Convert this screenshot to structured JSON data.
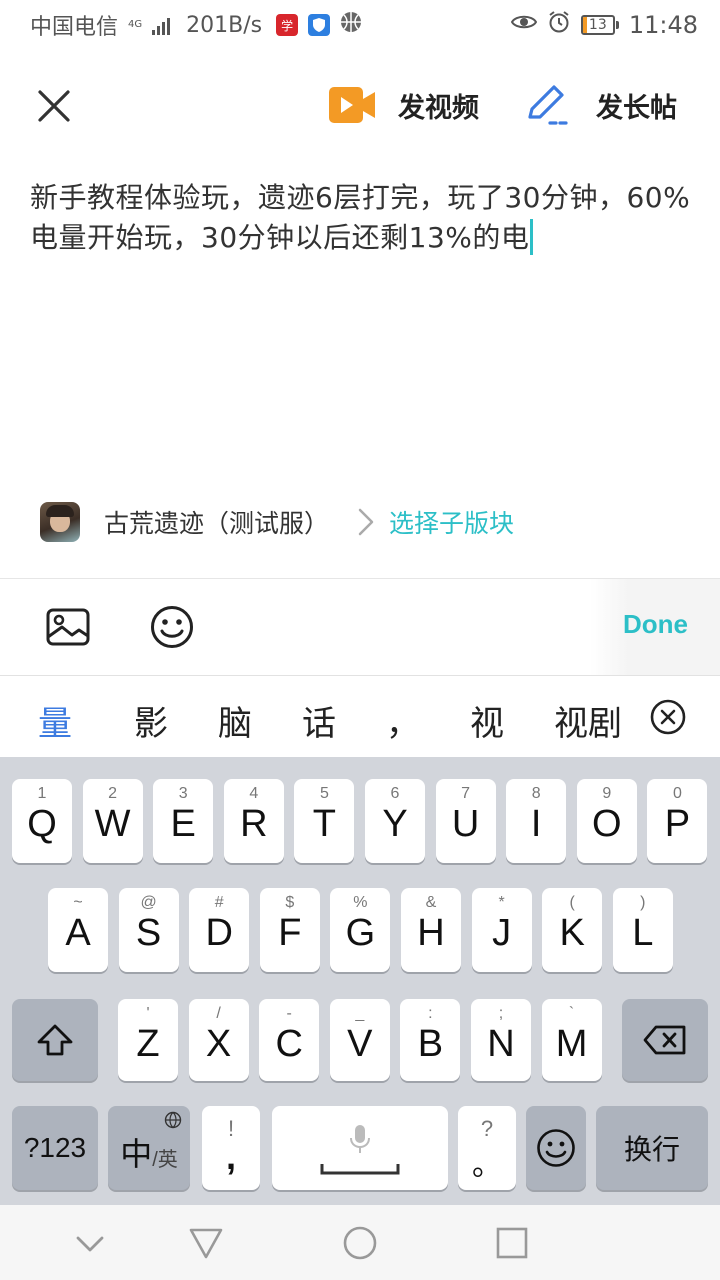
{
  "status_bar": {
    "carrier": "中国电信",
    "network_type": "4G",
    "net_speed": "201B/s",
    "battery_level": "13",
    "battery_fraction": 0.13,
    "time": "11:48",
    "icons": [
      "signal-icon",
      "news-app-icon",
      "shield-app-icon",
      "basketball-app-icon",
      "eye-icon",
      "alarm-icon",
      "battery-icon"
    ]
  },
  "header": {
    "close_icon": "close-icon",
    "post_video_label": "发视频",
    "post_long_label": "发长帖",
    "accent": "#f39a25",
    "pen_color": "#3d7be0"
  },
  "post": {
    "text": "新手教程体验玩，遗迹6层打完，玩了30分钟，60%电量开始玩，30分钟以后还剩13%的电"
  },
  "forum": {
    "name": "古荒遗迹（测试服）",
    "sub_forum_label": "选择子版块",
    "accent": "#2cbfc7"
  },
  "toolbar": {
    "image_icon": "image-icon",
    "emoji_icon": "emoji-icon",
    "done_label": "Done"
  },
  "candidates": {
    "items": [
      "量",
      "影",
      "脑",
      "话",
      "，",
      "视",
      "视剧"
    ],
    "active_index": 0
  },
  "keyboard": {
    "row1": [
      {
        "main": "Q",
        "sub": "1"
      },
      {
        "main": "W",
        "sub": "2"
      },
      {
        "main": "E",
        "sub": "3"
      },
      {
        "main": "R",
        "sub": "4"
      },
      {
        "main": "T",
        "sub": "5"
      },
      {
        "main": "Y",
        "sub": "6"
      },
      {
        "main": "U",
        "sub": "7"
      },
      {
        "main": "I",
        "sub": "8"
      },
      {
        "main": "O",
        "sub": "9"
      },
      {
        "main": "P",
        "sub": "0"
      }
    ],
    "row2": [
      {
        "main": "A",
        "sub": "~"
      },
      {
        "main": "S",
        "sub": "@"
      },
      {
        "main": "D",
        "sub": "#"
      },
      {
        "main": "F",
        "sub": "$"
      },
      {
        "main": "G",
        "sub": "%"
      },
      {
        "main": "H",
        "sub": "&"
      },
      {
        "main": "J",
        "sub": "*"
      },
      {
        "main": "K",
        "sub": "("
      },
      {
        "main": "L",
        "sub": ")"
      }
    ],
    "row3": [
      {
        "main": "Z",
        "sub": "'"
      },
      {
        "main": "X",
        "sub": "/"
      },
      {
        "main": "C",
        "sub": "-"
      },
      {
        "main": "V",
        "sub": "_"
      },
      {
        "main": "B",
        "sub": ":"
      },
      {
        "main": "N",
        "sub": ";"
      },
      {
        "main": "M",
        "sub": "`"
      }
    ],
    "symbols_label": "?123",
    "lang_main": "中",
    "lang_sub": "/英",
    "comma_sub": "!",
    "comma_main": ",",
    "period_sub": "?",
    "period_main": "。",
    "enter_label": "换行"
  },
  "navbar": {
    "icons": [
      "collapse-keyboard-icon",
      "back-icon",
      "home-icon",
      "recents-icon"
    ]
  }
}
